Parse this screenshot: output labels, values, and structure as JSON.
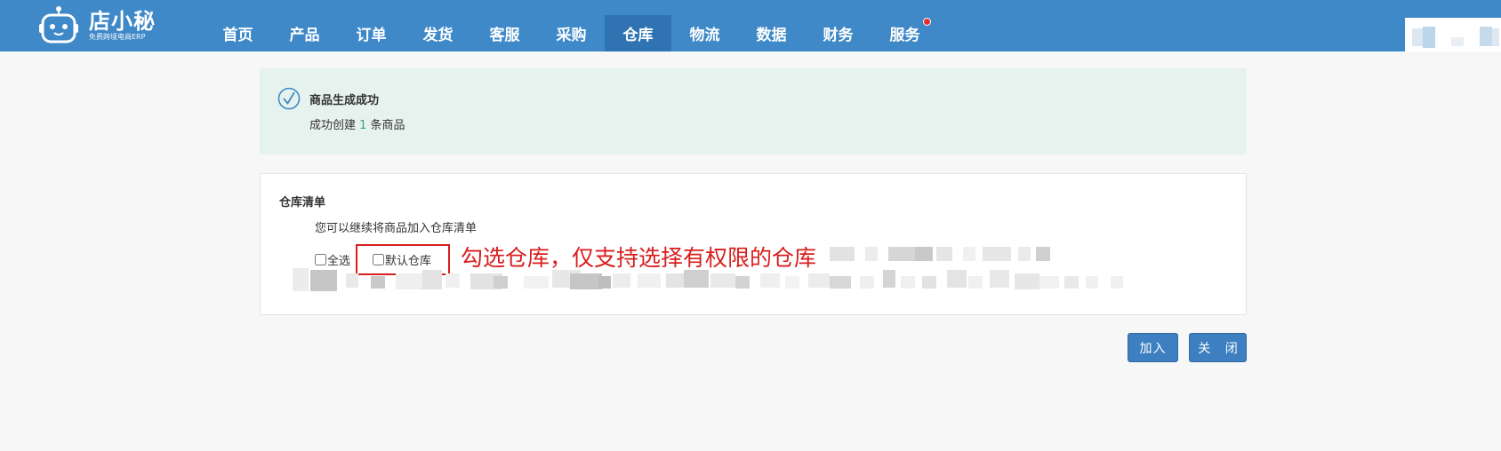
{
  "header": {
    "logo_title": "店小秘",
    "logo_subtitle": "免费跨境电商ERP",
    "nav_items": [
      {
        "label": "首页",
        "active": false,
        "dot": false
      },
      {
        "label": "产品",
        "active": false,
        "dot": false
      },
      {
        "label": "订单",
        "active": false,
        "dot": false
      },
      {
        "label": "发货",
        "active": false,
        "dot": false
      },
      {
        "label": "客服",
        "active": false,
        "dot": false
      },
      {
        "label": "采购",
        "active": false,
        "dot": false
      },
      {
        "label": "仓库",
        "active": true,
        "dot": false
      },
      {
        "label": "物流",
        "active": false,
        "dot": false
      },
      {
        "label": "数据",
        "active": false,
        "dot": false
      },
      {
        "label": "财务",
        "active": false,
        "dot": false
      },
      {
        "label": "服务",
        "active": false,
        "dot": true
      }
    ],
    "colors": {
      "bar": "#3f89c9",
      "active_tab": "#2f73b3",
      "notify_dot": "#e62e2e"
    }
  },
  "success": {
    "icon": "check-circle-icon",
    "title": "商品生成成功",
    "message_prefix": "成功创建 ",
    "count": "1",
    "message_suffix": " 条商品"
  },
  "warehouse": {
    "title": "仓库清单",
    "hint": "您可以继续将商品加入仓库清单",
    "select_all_label": "全选",
    "select_all_checked": false,
    "default_warehouse_label": "默认仓库",
    "default_warehouse_checked": false
  },
  "annotation": {
    "text": "勾选仓库，仅支持选择有权限的仓库",
    "color": "#d81e1e"
  },
  "buttons": {
    "add_label": "加入",
    "close_label": "关 闭"
  }
}
